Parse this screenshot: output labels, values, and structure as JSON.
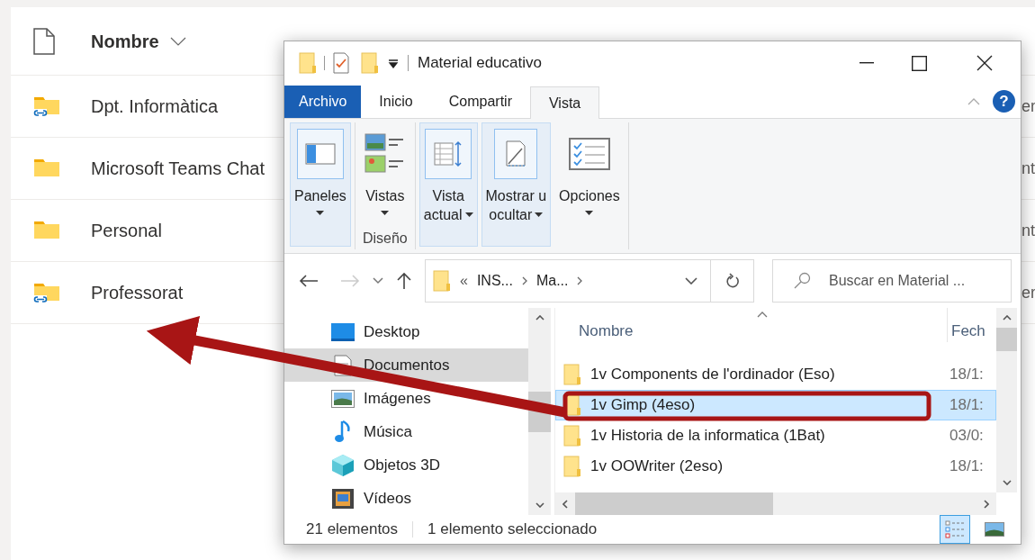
{
  "background_list": {
    "header": "Nombre",
    "rows": [
      {
        "name": "Dpt. Informàtica",
        "kind": "shared",
        "column_3": "er"
      },
      {
        "name": "Microsoft Teams Chat",
        "kind": "plain",
        "column_3": "nt"
      },
      {
        "name": "Personal",
        "kind": "plain",
        "column_3": "nt"
      },
      {
        "name": "Professorat",
        "kind": "shared",
        "column_3": "er"
      }
    ]
  },
  "window": {
    "title": "Material educativo",
    "ribbon_tabs": [
      {
        "label": "Archivo",
        "kind": "file",
        "selected": false
      },
      {
        "label": "Inicio",
        "kind": "tab",
        "selected": false
      },
      {
        "label": "Compartir",
        "kind": "tab",
        "selected": false
      },
      {
        "label": "Vista",
        "kind": "tab",
        "selected": true
      }
    ],
    "help": "?",
    "ribbon_buttons": [
      {
        "lines": [
          "Paneles"
        ],
        "kind": "panes",
        "highlighted": true
      },
      {
        "lines": [
          "Vistas"
        ],
        "kind": "layout",
        "highlighted": false,
        "group_label": "Diseño"
      },
      {
        "lines": [
          "Vista",
          "actual"
        ],
        "kind": "current",
        "highlighted": true
      },
      {
        "lines": [
          "Mostrar u",
          "ocultar"
        ],
        "kind": "showhide",
        "highlighted": true
      },
      {
        "lines": [
          "Opciones"
        ],
        "kind": "options",
        "highlighted": false
      }
    ],
    "address": {
      "prefix": "«",
      "crumbs": [
        "INS...",
        "Ma..."
      ]
    },
    "search": {
      "placeholder": "Buscar en Material ..."
    },
    "nav": [
      {
        "label": "Desktop",
        "kind": "desktop",
        "selected": false
      },
      {
        "label": "Documentos",
        "kind": "documents",
        "selected": true
      },
      {
        "label": "Imágenes",
        "kind": "pictures",
        "selected": false
      },
      {
        "label": "Música",
        "kind": "music",
        "selected": false
      },
      {
        "label": "Objetos 3D",
        "kind": "objects",
        "selected": false
      },
      {
        "label": "Vídeos",
        "kind": "videos",
        "selected": false
      }
    ],
    "columns": [
      "Nombre",
      "Fech"
    ],
    "files": [
      {
        "name": "1v Components de l'ordinador (Eso)",
        "date": "18/1:",
        "selected": false
      },
      {
        "name": "1v Gimp (4eso)",
        "date": "18/1:",
        "selected": true
      },
      {
        "name": "1v Historia de la informatica (1Bat)",
        "date": "03/0:",
        "selected": false
      },
      {
        "name": "1v OOWriter (2eso)",
        "date": "18/1:",
        "selected": false
      }
    ],
    "status": [
      "21 elementos",
      "1 elemento seleccionado"
    ],
    "view_buttons": [
      {
        "kind": "details",
        "selected": true
      },
      {
        "kind": "thumbnails",
        "selected": false
      }
    ]
  }
}
